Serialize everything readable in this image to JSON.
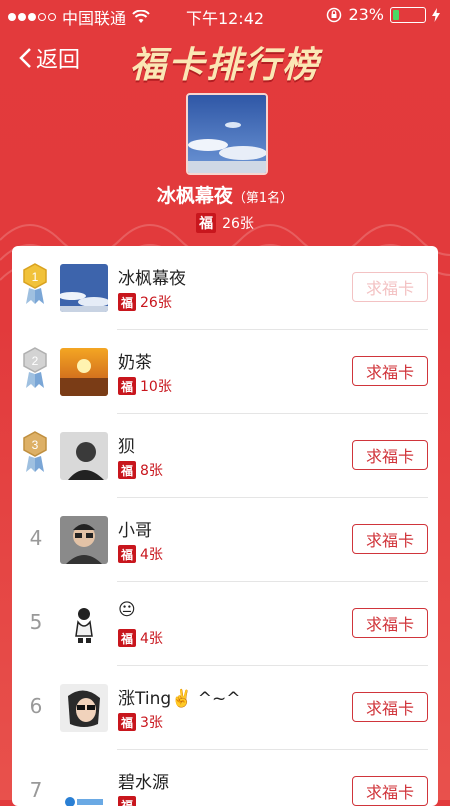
{
  "status_bar": {
    "carrier": "中国联通",
    "time": "下午12:42",
    "battery": "23%",
    "battery_level": 0.23
  },
  "nav": {
    "back_label": "返回",
    "title": "福卡排行榜"
  },
  "top_user": {
    "name": "冰枫幕夜",
    "rank_label": "（第1名）",
    "count": "26张"
  },
  "fu_char": "福",
  "rows": [
    {
      "rank": "1",
      "name": "冰枫幕夜",
      "count": "26张",
      "button": "求福卡",
      "button_disabled": true
    },
    {
      "rank": "2",
      "name": "奶茶",
      "count": "10张",
      "button": "求福卡",
      "button_disabled": false
    },
    {
      "rank": "3",
      "name": "狈",
      "count": "8张",
      "button": "求福卡",
      "button_disabled": false
    },
    {
      "rank": "4",
      "name": "小哥",
      "count": "4张",
      "button": "求福卡",
      "button_disabled": false
    },
    {
      "rank": "5",
      "name": "😐",
      "count": "4张",
      "button": "求福卡",
      "button_disabled": false
    },
    {
      "rank": "6",
      "name": "涨Ting✌️ ^~^",
      "count": "3张",
      "button": "求福卡",
      "button_disabled": false
    },
    {
      "rank": "7",
      "name": "碧水源",
      "count": "",
      "button": "求福卡",
      "button_disabled": false
    }
  ],
  "colors": {
    "background": "#e23b3d",
    "accent": "#d0353b",
    "gold": "#e4b24a",
    "silver": "#c9c9c9",
    "bronze": "#d9a45c"
  }
}
